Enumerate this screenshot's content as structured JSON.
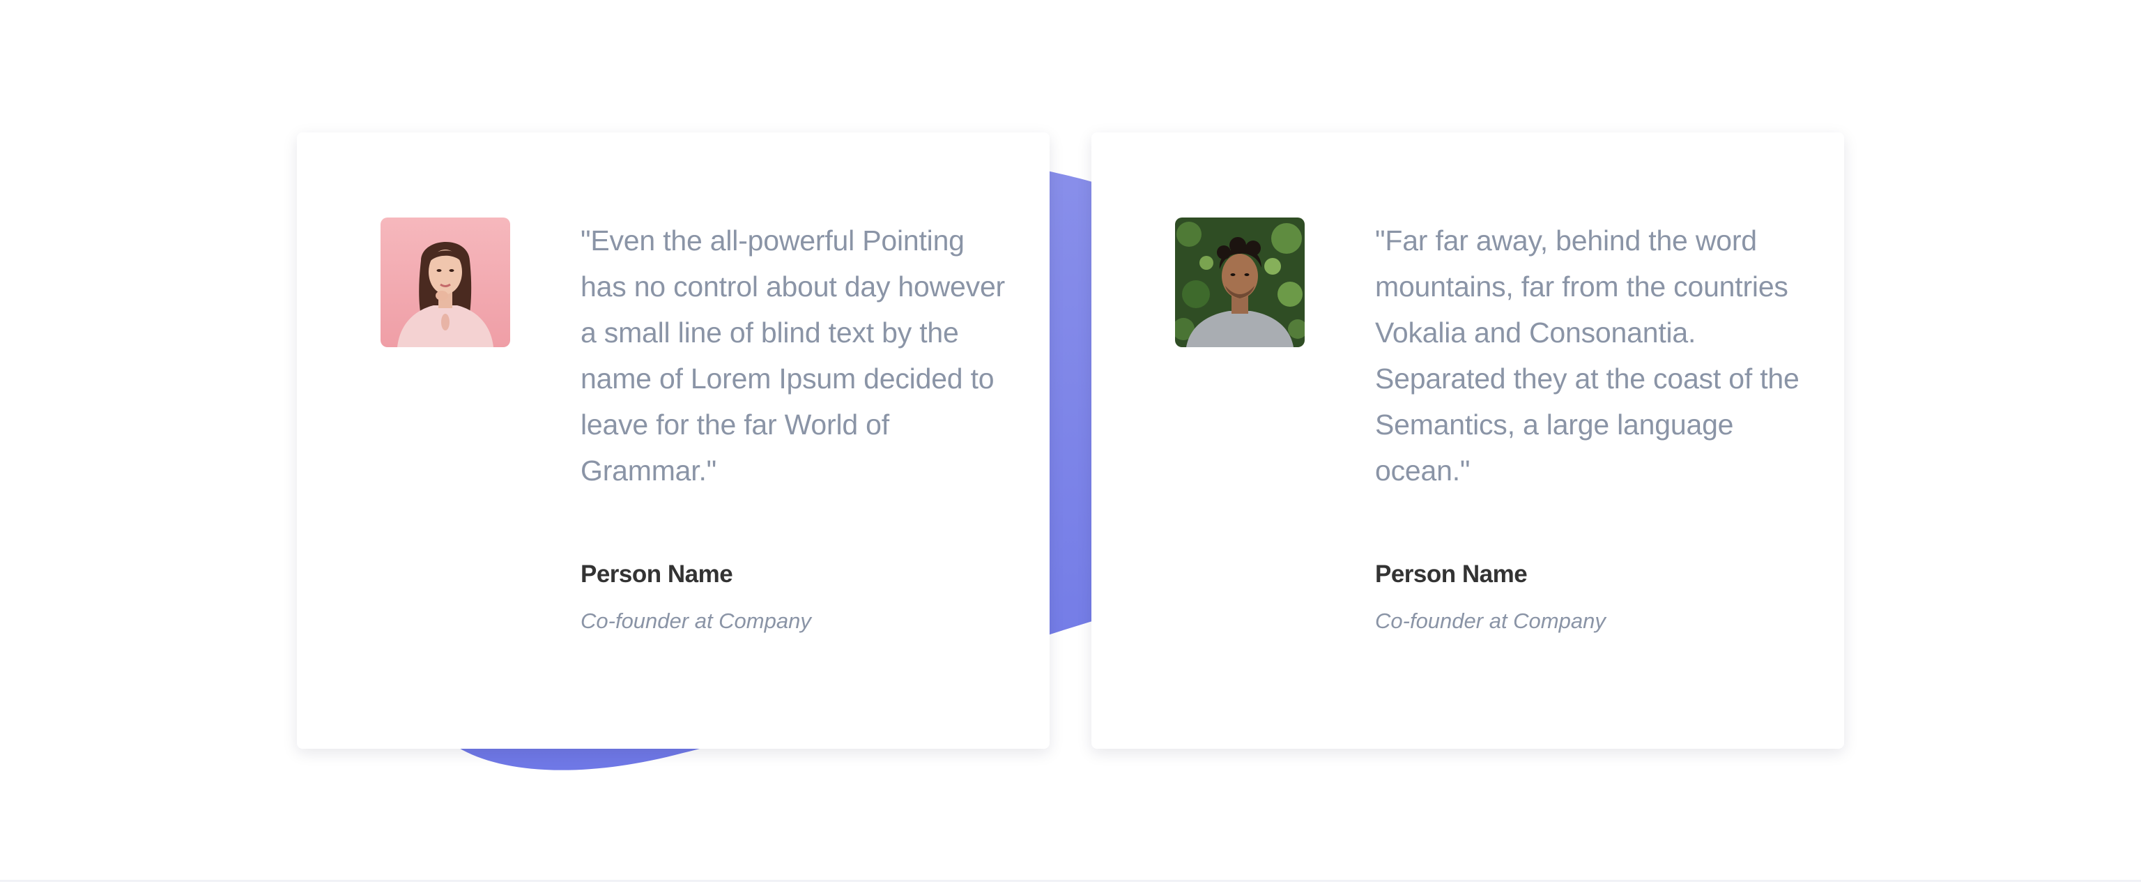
{
  "colors": {
    "blob": "#7b82e6",
    "quote_text": "#8a94a6",
    "name_text": "#333333"
  },
  "testimonials": [
    {
      "quote": "\"Even the all-powerful Pointing has no control about day however a small line of blind text by the name of Lorem Ipsum decided to leave for the far World of Grammar.\"",
      "name": "Person Name",
      "role": "Co-founder at Company",
      "avatar": "woman-portrait-pink-background"
    },
    {
      "quote": "\"Far far away, behind the word mountains, far from the countries Vokalia and Consonantia. Separated they at the coast of the Semantics, a large language ocean.\"",
      "name": "Person Name",
      "role": "Co-founder at Company",
      "avatar": "man-portrait-green-foliage"
    }
  ]
}
